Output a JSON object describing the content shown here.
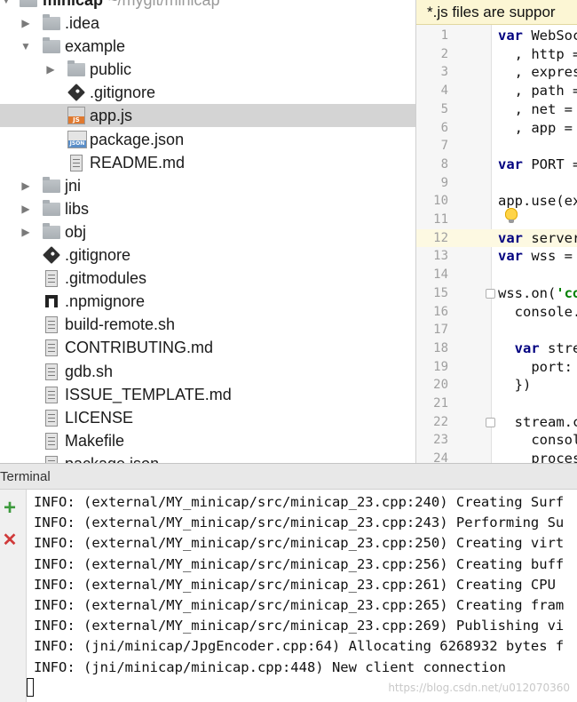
{
  "project": {
    "root": {
      "name": "minicap",
      "path": "~/mygit/minicap"
    },
    "items": [
      {
        "label": ".idea",
        "type": "folder",
        "level": 1,
        "expanded": false
      },
      {
        "label": "example",
        "type": "folder",
        "level": 1,
        "expanded": true
      },
      {
        "label": "public",
        "type": "folder",
        "level": 2,
        "expanded": false
      },
      {
        "label": ".gitignore",
        "type": "git",
        "level": 2
      },
      {
        "label": "app.js",
        "type": "js",
        "level": 2,
        "selected": true
      },
      {
        "label": "package.json",
        "type": "json",
        "level": 2
      },
      {
        "label": "README.md",
        "type": "doc",
        "level": 2
      },
      {
        "label": "jni",
        "type": "folder",
        "level": 1,
        "expanded": false
      },
      {
        "label": "libs",
        "type": "folder",
        "level": 1,
        "expanded": false
      },
      {
        "label": "obj",
        "type": "folder",
        "level": 1,
        "expanded": false
      },
      {
        "label": ".gitignore",
        "type": "git",
        "level": 1
      },
      {
        "label": ".gitmodules",
        "type": "doc",
        "level": 1
      },
      {
        "label": ".npmignore",
        "type": "npm",
        "level": 1
      },
      {
        "label": "build-remote.sh",
        "type": "doc",
        "level": 1
      },
      {
        "label": "CONTRIBUTING.md",
        "type": "doc",
        "level": 1
      },
      {
        "label": "gdb.sh",
        "type": "doc",
        "level": 1
      },
      {
        "label": "ISSUE_TEMPLATE.md",
        "type": "doc",
        "level": 1
      },
      {
        "label": "LICENSE",
        "type": "doc",
        "level": 1
      },
      {
        "label": "Makefile",
        "type": "doc",
        "level": 1
      },
      {
        "label": "package.json",
        "type": "doc",
        "level": 1
      }
    ]
  },
  "editor": {
    "banner": "*.js files are suppor",
    "current_line": 12,
    "lines": [
      {
        "n": "1",
        "code": "var WebSoc",
        "kw": "var",
        "fold": false
      },
      {
        "n": "2",
        "code": "  , http ="
      },
      {
        "n": "3",
        "code": "  , expres"
      },
      {
        "n": "4",
        "code": "  , path ="
      },
      {
        "n": "5",
        "code": "  , net ="
      },
      {
        "n": "6",
        "code": "  , app ="
      },
      {
        "n": "7",
        "code": ""
      },
      {
        "n": "8",
        "code": "var PORT =",
        "kw": "var"
      },
      {
        "n": "9",
        "code": ""
      },
      {
        "n": "10",
        "code": "app.use(ex"
      },
      {
        "n": "11",
        "code": ""
      },
      {
        "n": "12",
        "code": "var server",
        "kw": "var"
      },
      {
        "n": "13",
        "code": "var wss =",
        "kw": "var"
      },
      {
        "n": "14",
        "code": ""
      },
      {
        "n": "15",
        "code": "wss.on('co",
        "str": "'co",
        "fold": true
      },
      {
        "n": "16",
        "code": "  console."
      },
      {
        "n": "17",
        "code": ""
      },
      {
        "n": "18",
        "code": "  var stre",
        "kw": "var"
      },
      {
        "n": "19",
        "code": "    port:"
      },
      {
        "n": "20",
        "code": "  })"
      },
      {
        "n": "21",
        "code": ""
      },
      {
        "n": "22",
        "code": "  stream.c",
        "fold": true
      },
      {
        "n": "23",
        "code": "    consol"
      },
      {
        "n": "24",
        "code": "    proces"
      }
    ]
  },
  "terminal": {
    "title": "Terminal",
    "lines": [
      "INFO: (external/MY_minicap/src/minicap_23.cpp:240) Creating Surf",
      "INFO: (external/MY_minicap/src/minicap_23.cpp:243) Performing Su",
      "INFO: (external/MY_minicap/src/minicap_23.cpp:250) Creating virt",
      "INFO: (external/MY_minicap/src/minicap_23.cpp:256) Creating buff",
      "INFO: (external/MY_minicap/src/minicap_23.cpp:261) Creating CPU ",
      "INFO: (external/MY_minicap/src/minicap_23.cpp:265) Creating fram",
      "INFO: (external/MY_minicap/src/minicap_23.cpp:269) Publishing vi",
      "INFO: (jni/minicap/JpgEncoder.cpp:64) Allocating 6268932 bytes f",
      "INFO: (jni/minicap/minicap.cpp:448) New client connection"
    ],
    "add_symbol": "+",
    "close_symbol": "✕",
    "colors": {
      "add": "#3c9a3c",
      "close": "#d03a3a"
    }
  },
  "watermark": "https://blog.csdn.net/u012070360"
}
